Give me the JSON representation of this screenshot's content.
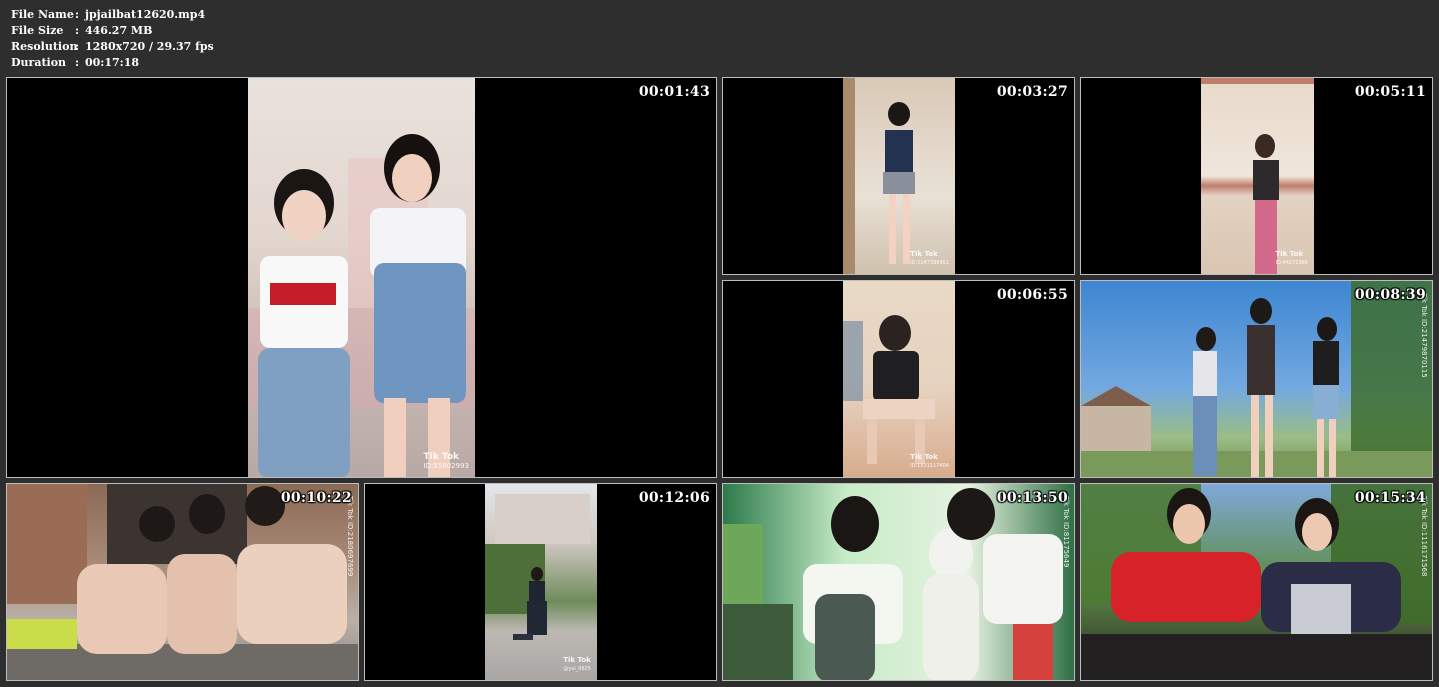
{
  "info": {
    "rows": [
      {
        "key": "File Name",
        "value": "jpjailbat12620.mp4"
      },
      {
        "key": "File Size",
        "value": "446.27 MB"
      },
      {
        "key": "Resolution",
        "value": "1280x720 / 29.37 fps"
      },
      {
        "key": "Duration",
        "value": "00:17:18"
      }
    ],
    "separator": ":"
  },
  "thumbnails": [
    {
      "timestamp": "00:01:43",
      "watermark": "Tik Tok",
      "watermark_id": "ID:55802993"
    },
    {
      "timestamp": "00:03:27",
      "watermark": "Tik Tok",
      "watermark_id": "ID:2147389951"
    },
    {
      "timestamp": "00:05:11",
      "watermark": "Tik Tok",
      "watermark_id": "ID:44271986"
    },
    {
      "timestamp": "00:06:55",
      "watermark": "Tik Tok",
      "watermark_id": "ID:1531117404"
    },
    {
      "timestamp": "00:08:39",
      "watermark": "Tik Tok",
      "watermark_id": "ID:21479870115"
    },
    {
      "timestamp": "00:10:22",
      "watermark": "Tik Tok",
      "watermark_id": "ID:2180697699"
    },
    {
      "timestamp": "00:12:06",
      "watermark": "Tik Tok",
      "watermark_id": "@yui_0825"
    },
    {
      "timestamp": "00:13:50",
      "watermark": "Tik Tok",
      "watermark_id": "ID:81175649"
    },
    {
      "timestamp": "00:15:34",
      "watermark": "Tik Tok",
      "watermark_id": "ID:1116171568"
    }
  ]
}
